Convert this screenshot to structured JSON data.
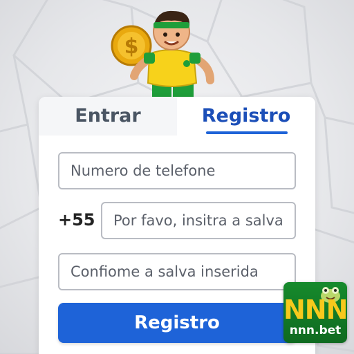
{
  "tabs": {
    "login_label": "Entrar",
    "register_label": "Registro",
    "active": "register"
  },
  "form": {
    "phone_placeholder": "Numero de telefone",
    "country_code": "+55",
    "password_placeholder": "Por favo, insitra a salva",
    "confirm_placeholder": "Confiome a salva inserida",
    "submit_label": "Registro"
  },
  "brand": {
    "logo_text": "NNN",
    "domain": "nnn.bet"
  },
  "colors": {
    "accent": "#1e63d8",
    "tab_active_text": "#1c4fb8",
    "tab_inactive_text": "#4a5563",
    "badge_bg": "#168a2c",
    "badge_logo": "#f7c91c"
  },
  "icons": {
    "mascot": "soccer-player-mascot",
    "coin": "dollar-coin-icon",
    "badge_mascot": "frog-mascot-icon"
  }
}
